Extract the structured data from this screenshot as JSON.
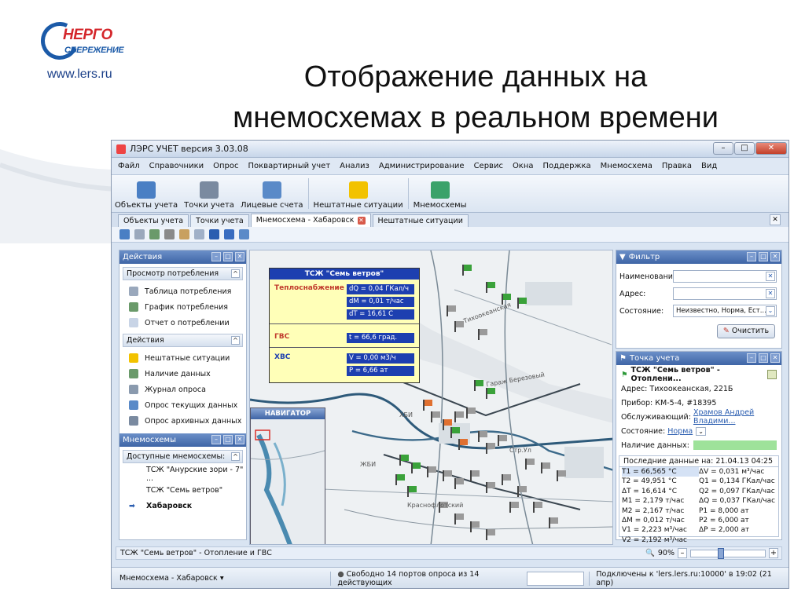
{
  "slide": {
    "logo_line1": "НЕРГО",
    "logo_line2": "СБЕРЕЖЕНИЕ",
    "website": "www.lers.ru",
    "title_line1": "Отображение данных на",
    "title_line2": "мнемосхемах в реальном времени"
  },
  "window": {
    "title": "ЛЭРС УЧЕТ версия 3.03.08"
  },
  "menu": [
    "Файл",
    "Справочники",
    "Опрос",
    "Поквартирный учет",
    "Анализ",
    "Администрирование",
    "Сервис",
    "Окна",
    "Поддержка",
    "Мнемосхема",
    "Правка",
    "Вид"
  ],
  "ribbon": [
    {
      "label": "Объекты учета",
      "icon": "house-icon",
      "color": "#4a7fc4"
    },
    {
      "label": "Точки учета",
      "icon": "meter-icon",
      "color": "#7a8aa0"
    },
    {
      "label": "Лицевые счета",
      "icon": "accounts-icon",
      "color": "#5a8ac8"
    },
    {
      "label": "Нештатные ситуации",
      "icon": "warning-icon",
      "color": "#f2c200"
    },
    {
      "label": "Мнемосхемы",
      "icon": "mnemo-icon",
      "color": "#3aa26a"
    }
  ],
  "tabs": [
    {
      "label": "Объекты учета",
      "active": false
    },
    {
      "label": "Точки учета",
      "active": false
    },
    {
      "label": "Мнемосхема - Хабаровск",
      "active": true
    },
    {
      "label": "Нештатные ситуации",
      "active": false
    }
  ],
  "actions_panel": {
    "title": "Действия",
    "section1": "Просмотр потребления",
    "section1_items": [
      "Таблица потребления",
      "График потребления",
      "Отчет о потреблении"
    ],
    "section2": "Действия",
    "section2_items": [
      "Нештатные ситуации",
      "Наличие данных",
      "Журнал опроса",
      "Опрос текущих данных",
      "Опрос архивных данных"
    ]
  },
  "mnemo_panel": {
    "title": "Мнемосхемы",
    "section": "Доступные мнемосхемы:",
    "items": [
      "ТСЖ \"Анурские зори - 7\" ...",
      "ТСЖ \"Семь ветров\"",
      "Хабаровск"
    ]
  },
  "info_box": {
    "title": "ТСЖ \"Семь ветров\"",
    "heat_label": "Теплоснабжение",
    "heat_values": [
      "dQ = 0,04 ГКал/ч",
      "dM = 0,01 т/час",
      "dT = 16,61 C"
    ],
    "gvs_label": "ГВС",
    "gvs_values": [
      "t = 66,6 град."
    ],
    "hvs_label": "ХВС",
    "hvs_values": [
      "V = 0,00 м3/ч",
      "P = 6,66 ат"
    ]
  },
  "map_labels": [
    "Тихоокеанская",
    "ЖБИ",
    "ХБИ",
    "Краснофлотский",
    "Гараж Березовый",
    "Стр.Ул"
  ],
  "navigator": {
    "title": "НАВИГАТОР"
  },
  "filter": {
    "title": "Фильтр",
    "name_label": "Наименование:",
    "address_label": "Адрес:",
    "state_label": "Состояние:",
    "state_value": "Неизвестно, Норма, Ест...",
    "clear_label": "Очистить"
  },
  "point": {
    "title": "Точка учета",
    "name": "ТСЖ \"Семь ветров\" - Отоплени...",
    "address_label": "Адрес:",
    "address_value": "Тихоокеанская, 221Б",
    "device_label": "Прибор:",
    "device_value": "КМ-5-4, #18395",
    "service_label": "Обслуживающий:",
    "service_value": "Храмов Андрей Владими...",
    "state_label": "Состояние:",
    "state_value": "Норма",
    "data_label": "Наличие данных:",
    "last_data": "Последние данные на: 21.04.13 04:25",
    "left_values": [
      "T1 = 66,565 °C",
      "T2 = 49,951 °C",
      "ΔT = 16,614 °C",
      "M1 = 2,179 т/час",
      "M2 = 2,167 т/час",
      "ΔM = 0,012 т/час",
      "V1 = 2,223 м³/час",
      "V2 = 2,192 м³/час"
    ],
    "right_values": [
      "ΔV = 0,031 м³/час",
      "Q1 = 0,134 ГКал/час",
      "Q2 = 0,097 ГКал/час",
      "ΔQ = 0,037 ГКал/час",
      "P1 = 8,000 ат",
      "P2 = 6,000 ат",
      "ΔP = 2,000 ат",
      ""
    ]
  },
  "status_row": {
    "text": "ТСЖ \"Семь ветров\" - Отопление и ГВС",
    "zoom": "90%"
  },
  "statusbar": {
    "mnemo": "Мнемосхема - Хабаровск",
    "ports": "Свободно 14 портов опроса из 14 действующих",
    "connection": "Подключены к 'lers.lers.ru:10000' в 19:02 (21 апр)"
  }
}
